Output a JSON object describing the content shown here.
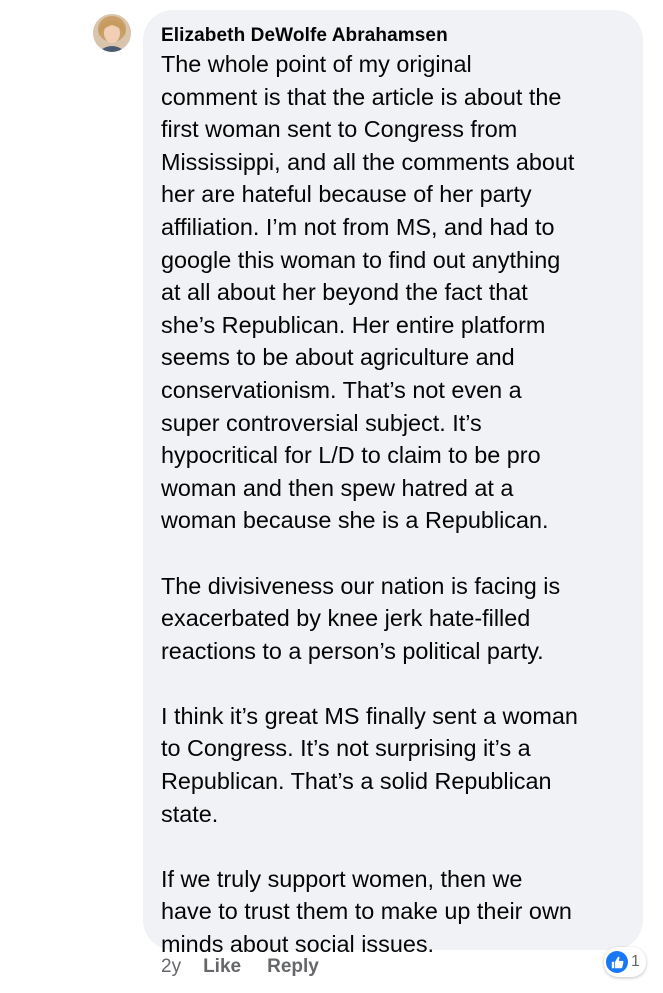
{
  "comment": {
    "author": "Elizabeth DeWolfe Abrahamsen",
    "paragraphs": [
      {
        "lines": [
          "The whole point of my original",
          "comment is that the article is about the",
          "first woman sent to Congress from",
          "Mississippi, and all the comments about",
          "her are hateful because of her party",
          "affiliation. I’m not from MS, and had to",
          "google this woman to find out anything",
          "at all about her beyond the fact that",
          "she’s Republican. Her entire platform",
          "seems to be about agriculture and",
          "conservationism. That’s not even a",
          "super controversial subject. It’s",
          "hypocritical for L/D to claim to be pro",
          "woman and then spew hatred at a",
          "woman because she is a Republican."
        ]
      },
      {
        "lines": [
          "The divisiveness our nation is facing is",
          "exacerbated by knee jerk hate-filled",
          "reactions to a person’s political party."
        ]
      },
      {
        "lines": [
          "I think it’s great MS finally sent a woman",
          "to Congress. It’s not surprising it’s a",
          "Republican. That’s a solid Republican",
          "state."
        ]
      },
      {
        "lines": [
          "If we truly support women, then we",
          "have to trust them to make up their own",
          "minds about social issues."
        ]
      }
    ]
  },
  "meta": {
    "timestamp": "2y",
    "like_label": "Like",
    "reply_label": "Reply"
  },
  "reactions": {
    "icon": "like-icon",
    "count": "1",
    "color": "#1877f2"
  },
  "colors": {
    "bubble": "#f0f2f5",
    "text": "#050505",
    "secondary": "#65676b"
  }
}
